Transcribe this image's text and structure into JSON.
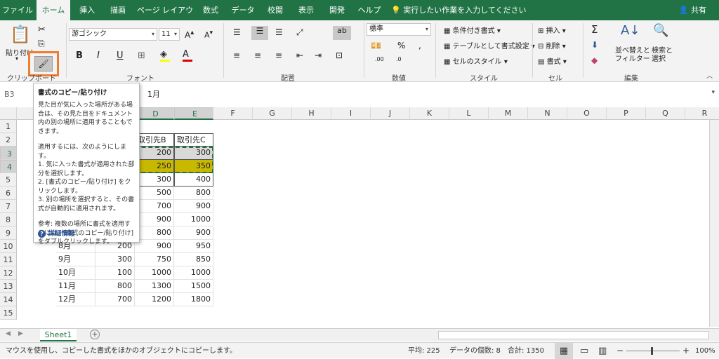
{
  "colors": {
    "accent": "#217346",
    "highlight": "#c9b800",
    "painter_border": "#ed7d31"
  },
  "tabs": [
    "ファイル",
    "ホーム",
    "挿入",
    "描画",
    "ページ レイアウト",
    "数式",
    "データ",
    "校閲",
    "表示",
    "開発",
    "ヘルプ"
  ],
  "tell_me": "実行したい作業を入力してください",
  "share": "共有",
  "ribbon": {
    "clipboard": {
      "paste": "貼り付け",
      "label": "クリップボード"
    },
    "font": {
      "name": "游ゴシック",
      "size": "11",
      "label": "フォント",
      "bold": "B",
      "italic": "I",
      "underline": "U"
    },
    "alignment": {
      "label": "配置"
    },
    "number": {
      "format": "標準",
      "label": "数値",
      "percent": "%"
    },
    "styles": {
      "conditional": "条件付き書式",
      "table": "テーブルとして書式設定",
      "cell_styles": "セルのスタイル",
      "label": "スタイル"
    },
    "cells": {
      "insert": "挿入",
      "delete": "削除",
      "format": "書式",
      "label": "セル"
    },
    "editing": {
      "sum": "Σ",
      "sort1": "並べ替えと",
      "sort2": "フィルター",
      "find1": "検索と",
      "find2": "選択",
      "label": "編集"
    }
  },
  "formula_bar": {
    "name_box": "B3",
    "value": "1月"
  },
  "grid": {
    "columns": [
      "A",
      "B",
      "C",
      "D",
      "E",
      "F",
      "G",
      "H",
      "I",
      "J",
      "K",
      "L",
      "M",
      "N",
      "O",
      "P",
      "Q",
      "R"
    ],
    "rows": [
      "1",
      "2",
      "3",
      "4",
      "5",
      "6",
      "7",
      "8",
      "9",
      "10",
      "11",
      "12",
      "13",
      "14",
      "15"
    ],
    "headers_row2": {
      "D": "取引先B",
      "E": "取引先C"
    },
    "data": [
      {
        "row": 3,
        "D": "200",
        "E": "300"
      },
      {
        "row": 4,
        "D": "250",
        "E": "350"
      },
      {
        "row": 5,
        "D": "300",
        "E": "400"
      },
      {
        "row": 6,
        "D": "500",
        "E": "800"
      },
      {
        "row": 7,
        "D": "700",
        "E": "900"
      },
      {
        "row": 8,
        "D": "900",
        "E": "1000"
      },
      {
        "row": 9,
        "D": "800",
        "E": "900"
      },
      {
        "row": 10,
        "B": "8月",
        "C": "200",
        "D": "900",
        "E": "950"
      },
      {
        "row": 11,
        "B": "9月",
        "C": "300",
        "D": "750",
        "E": "850"
      },
      {
        "row": 12,
        "B": "10月",
        "C": "100",
        "D": "1000",
        "E": "1000"
      },
      {
        "row": 13,
        "B": "11月",
        "C": "800",
        "D": "1300",
        "E": "1500"
      },
      {
        "row": 14,
        "B": "12月",
        "C": "700",
        "D": "1200",
        "E": "1800"
      }
    ]
  },
  "tooltip": {
    "title": "書式のコピー/貼り付け",
    "p1": "見た目が気に入った場所がある場合は、その見た目をドキュメント内の別の場所に適用することもできます。",
    "p2": "適用するには、次のようにします。\n1. 気に入った書式が適用された部分を選択します。\n2. [書式のコピー/貼り付け] をクリックします。\n3. 別の場所を選択すると、その書式が自動的に適用されます。",
    "p3": "参考: 複数の場所に書式を適用するには、[書式のコピー/貼り付け] をダブルクリックします。",
    "more": "詳細情報"
  },
  "sheet_tab": "Sheet1",
  "status": {
    "message": "マウスを使用し、コピーした書式をほかのオブジェクトにコピーします。",
    "average": "平均: 225",
    "count": "データの個数: 8",
    "sum": "合計: 1350",
    "zoom": "100%"
  }
}
